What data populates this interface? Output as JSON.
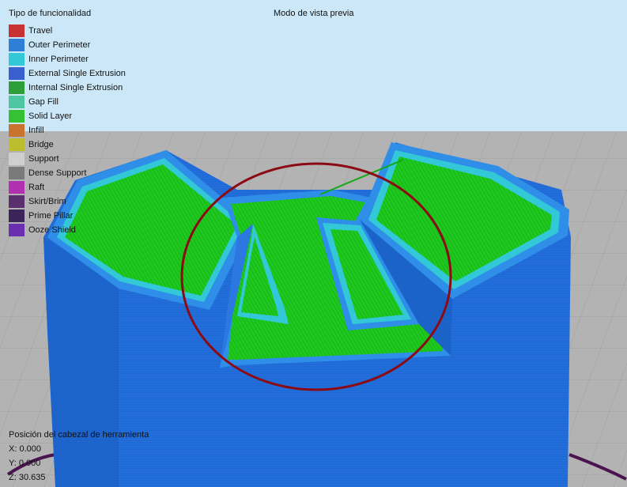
{
  "legend": {
    "title": "Tipo de funcionalidad",
    "items": [
      {
        "label": "Travel",
        "color": "#c83232"
      },
      {
        "label": "Outer Perimeter",
        "color": "#2f7fd6"
      },
      {
        "label": "Inner Perimeter",
        "color": "#33c8d8"
      },
      {
        "label": "External Single Extrusion",
        "color": "#3a5fcf"
      },
      {
        "label": "Internal Single Extrusion",
        "color": "#2e9e3a"
      },
      {
        "label": "Gap Fill",
        "color": "#4ec7a0"
      },
      {
        "label": "Solid Layer",
        "color": "#34c234"
      },
      {
        "label": "Infill",
        "color": "#c8742e"
      },
      {
        "label": "Bridge",
        "color": "#bdbd2e"
      },
      {
        "label": "Support",
        "color": "#cfcfcf"
      },
      {
        "label": "Dense Support",
        "color": "#7a7a7a"
      },
      {
        "label": "Raft",
        "color": "#b12fb1"
      },
      {
        "label": "Skirt/Brim",
        "color": "#5a2f6e"
      },
      {
        "label": "Prime Pillar",
        "color": "#3b2457"
      },
      {
        "label": "Ooze Shield",
        "color": "#6a2fb0"
      }
    ]
  },
  "view_mode_title": "Modo de vista previa",
  "toolhead": {
    "title": "Posición del cabezal de herramienta",
    "x": "X: 0.000",
    "y": "Y: 0.000",
    "z": "Z: 30.635"
  },
  "colors": {
    "sky": "#cce8f8",
    "floor": "#b3b3b3",
    "model_wall": "#1e6fd6",
    "perimeter": "#2f8fe8",
    "inner_perimeter": "#33c8d8",
    "solid_layer": "#22cc22",
    "highlight_circle": "#8b0a14",
    "skirt": "#4a1450"
  }
}
